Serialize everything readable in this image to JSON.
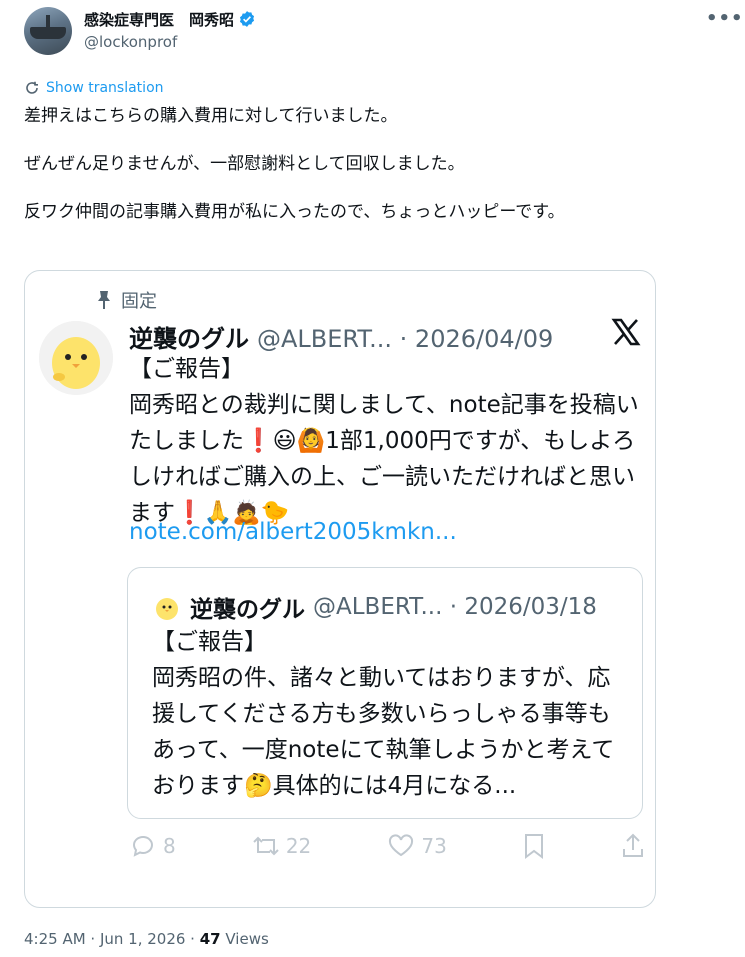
{
  "tweet": {
    "author_name": "感染症専門医　岡秀昭",
    "author_handle": "@lockonprof",
    "more_label": "•••",
    "show_translation": "Show translation",
    "text": "差押えはこちらの購入費用に対して行いました。\n\nぜんぜん足りませんが、一部慰謝料として回収しました。\n\n反ワク仲間の記事購入費用が私に入ったので、ちょっとハッピーです。",
    "time": "4:25 AM · Jun 1, 2026 · ",
    "views_count": "47",
    "views_label": " Views"
  },
  "quoted": {
    "pinned_label": "固定",
    "name": "逆襲のグル",
    "handle_date": "@ALBERT... · 2026/04/09",
    "text": "【ご報告】\n岡秀昭との裁判に関しまして、note記事を投稿いたしました❗😃🙆1部1,000円ですが、もしよろしければご購入の上、ご一読いただければと思います❗🙏🙇🐤",
    "link": "note.com/albert2005kmkn...",
    "inner": {
      "name": "逆襲のグル",
      "handle_date": "@ALBERT... · 2026/03/18",
      "text": "【ご報告】\n岡秀昭の件、諸々と動いてはおりますが、応援してくださる方も多数いらっしゃる事等もあって、一度noteにて執筆しようかと考えております🤔具体的には4月になる..."
    },
    "actions": {
      "replies": "8",
      "reposts": "22",
      "likes": "73"
    }
  },
  "colors": {
    "accent": "#1d9bf0",
    "muted": "#536471",
    "border": "#cfd9de"
  },
  "icons": [
    "verified-badge-icon",
    "translate-icon",
    "pin-icon",
    "x-logo-icon",
    "reply-icon",
    "repost-icon",
    "like-icon",
    "bookmark-icon",
    "share-icon"
  ]
}
